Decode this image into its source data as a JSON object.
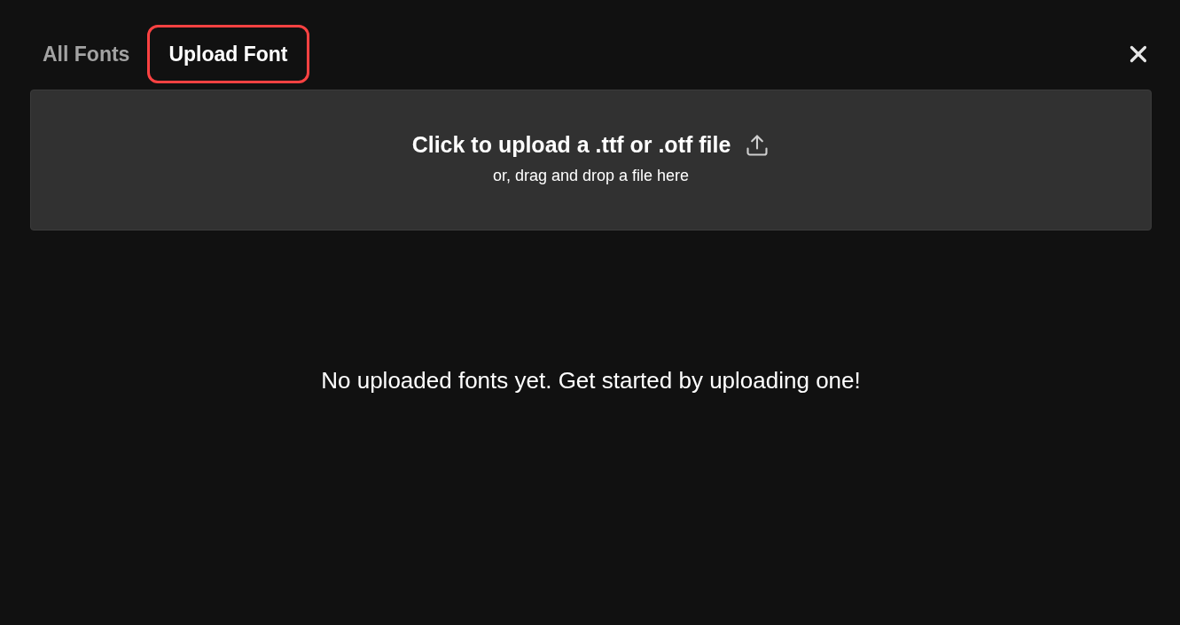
{
  "tabs": [
    {
      "label": "All Fonts",
      "selected": false
    },
    {
      "label": "Upload Font",
      "selected": true
    }
  ],
  "upload_zone": {
    "title": "Click to upload a .ttf or .otf file",
    "subtitle": "or, drag and drop a file here"
  },
  "empty_state": {
    "message": "No uploaded fonts yet. Get started by uploading one!"
  }
}
